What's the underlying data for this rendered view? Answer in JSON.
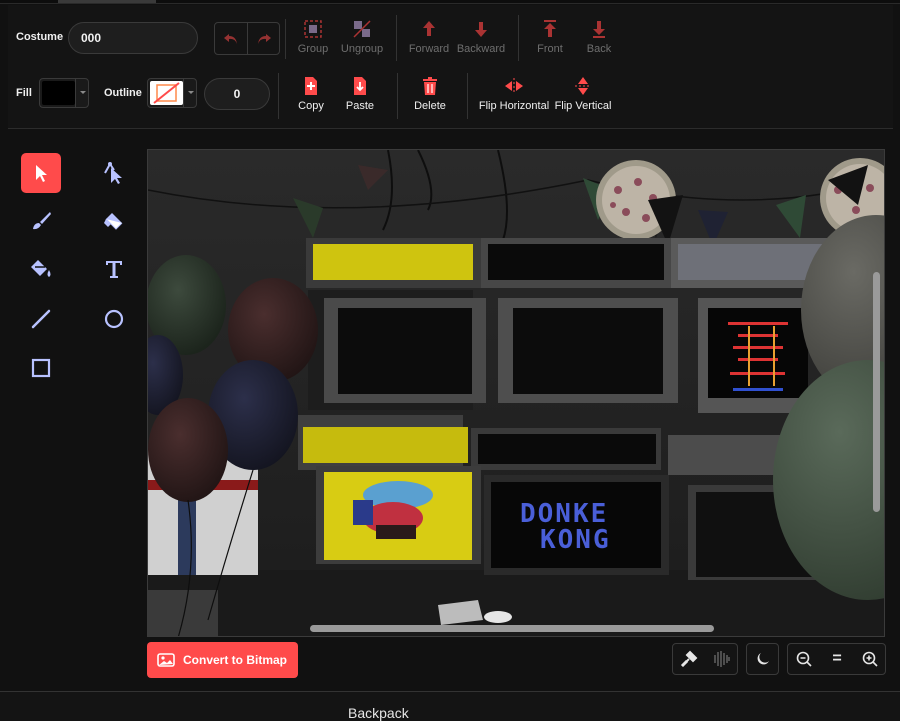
{
  "costume": {
    "label": "Costume",
    "name_value": "000"
  },
  "edit_actions": {
    "undo": "undo-icon",
    "redo": "redo-icon",
    "group": "Group",
    "ungroup": "Ungroup",
    "forward": "Forward",
    "backward": "Backward",
    "front": "Front",
    "back": "Back"
  },
  "style": {
    "fill_label": "Fill",
    "outline_label": "Outline",
    "outline_width": "0",
    "fill_color": "#000000",
    "outline_color": "none"
  },
  "clipboard": {
    "copy": "Copy",
    "paste": "Paste",
    "delete": "Delete"
  },
  "flip": {
    "horizontal": "Flip Horizontal",
    "vertical": "Flip Vertical"
  },
  "tools": [
    {
      "name": "select",
      "icon": "arrow-cursor-icon",
      "active": true
    },
    {
      "name": "reshape",
      "icon": "reshape-icon",
      "active": false
    },
    {
      "name": "brush",
      "icon": "brush-icon",
      "active": false
    },
    {
      "name": "eraser",
      "icon": "eraser-icon",
      "active": false
    },
    {
      "name": "fill",
      "icon": "paint-bucket-icon",
      "active": false
    },
    {
      "name": "text",
      "icon": "text-icon",
      "active": false
    },
    {
      "name": "line",
      "icon": "line-icon",
      "active": false
    },
    {
      "name": "circle",
      "icon": "circle-icon",
      "active": false
    },
    {
      "name": "rectangle",
      "icon": "rectangle-icon",
      "active": false
    }
  ],
  "canvas": {
    "arcade_screen_text": [
      "DONKE",
      "KONG"
    ]
  },
  "convert_button": "Convert to Bitmap",
  "zoom_controls": {
    "zoom_out": "zoom-out-icon",
    "reset": "=",
    "zoom_in": "zoom-in-icon"
  },
  "backpack": "Backpack",
  "colors": {
    "accent": "#ff4b4b",
    "background": "#111111",
    "disabled": "#6e6e6e"
  }
}
